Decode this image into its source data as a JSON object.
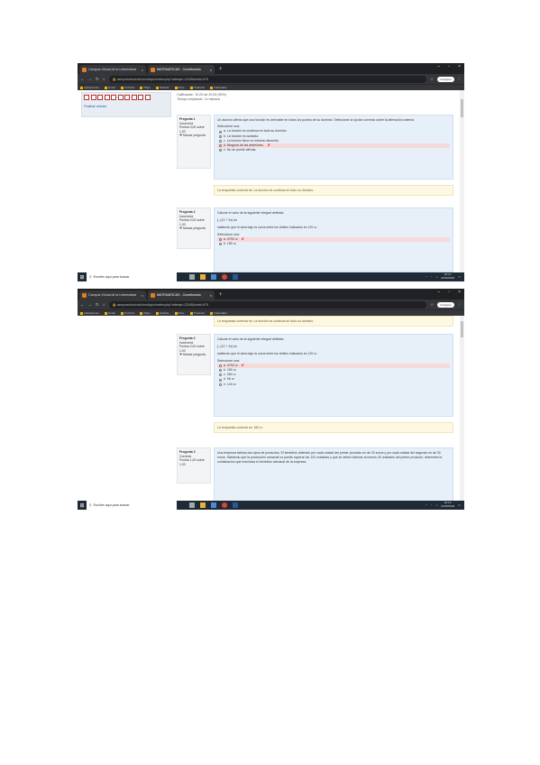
{
  "screens": [
    {
      "tabs": [
        {
          "title": "Campus Virtual de la Universidad"
        },
        {
          "title": "MATEMATICAS - Cuestionario"
        }
      ],
      "url": "campusvirtual.edu/mod/quiz/review.php?attempt=12345&cmid=678",
      "profile": "Incógnito",
      "bookmarks": [
        "Aplicaciones",
        "Gmail",
        "YouTube",
        "Maps",
        "Noticias",
        "Drive",
        "Traductor",
        "Calendario"
      ],
      "info_rows": [
        {
          "label": "Calificación",
          "value": "10,00 de 20,00 (50%)"
        },
        {
          "label": "Tiempo empleado",
          "value": "14 minutos"
        }
      ],
      "finish_review": "Finalizar revisión",
      "q1": {
        "header": "Pregunta 1",
        "state": "Incorrecta",
        "score": "Puntúa 0,00 sobre 1,00",
        "flag": "Marcar pregunta",
        "text": "Un alumno afirma que una función es derivable en todos los puntos de su dominio. Seleccione la opción correcta sobre la afirmación anterior.",
        "prompt": "Seleccione una:",
        "options": [
          {
            "label": "a. La función es continua en todo su dominio.",
            "state": ""
          },
          {
            "label": "b. La función es acotada.",
            "state": ""
          },
          {
            "label": "c. La función tiene un máximo absoluto.",
            "state": ""
          },
          {
            "label": "d. Ninguna de las anteriores.",
            "state": "wrong",
            "mark": "✗"
          },
          {
            "label": "e. No se puede afirmar.",
            "state": ""
          }
        ],
        "feedback": "La respuesta correcta es: La función es continua en todo su dominio."
      },
      "q2": {
        "header": "Pregunta 2",
        "state": "Incorrecta",
        "score": "Puntúa 0,00 sobre 1,00",
        "flag": "Marcar pregunta",
        "text": "Calcule el valor de la siguiente integral definida:",
        "formula": "∫₀ (12 + 3x) dx",
        "text2": "sabiendo que el área bajo la curva entre los límites indicados es 120 u².",
        "prompt": "Seleccione una:",
        "options": [
          {
            "label": "a. 4792 u²",
            "state": "wrong",
            "mark": "✗"
          },
          {
            "label": "b. 180 u²",
            "state": ""
          }
        ]
      },
      "taskbar": {
        "search": "Escribe aquí para buscar",
        "time": "20:14",
        "date": "21/05/2020"
      }
    },
    {
      "tabs": [
        {
          "title": "Campus Virtual de la Universidad"
        },
        {
          "title": "MATEMATICAS - Cuestionario"
        }
      ],
      "url": "campusvirtual.edu/mod/quiz/review.php?attempt=12345&cmid=678",
      "profile": "Incógnito",
      "bookmarks": [
        "Aplicaciones",
        "Gmail",
        "YouTube",
        "Maps",
        "Noticias",
        "Drive",
        "Traductor",
        "Calendario"
      ],
      "top_feedback": "La respuesta correcta es: La función es continua en todo su dominio.",
      "q2": {
        "header": "Pregunta 2",
        "state": "Incorrecta",
        "score": "Puntúa 0,00 sobre 1,00",
        "flag": "Marcar pregunta",
        "text": "Calcule el valor de la siguiente integral definida:",
        "formula": "∫₀ (12 + 3x) dx",
        "text2": "sabiendo que el área bajo la curva entre los límites indicados es 120 u².",
        "prompt": "Seleccione una:",
        "options": [
          {
            "label": "a. 4792 u²",
            "state": "wrong",
            "mark": "✗"
          },
          {
            "label": "b. 180 u²",
            "state": ""
          },
          {
            "label": "c. 264 u²",
            "state": ""
          },
          {
            "label": "d. 96 u²",
            "state": ""
          },
          {
            "label": "e. 144 u²",
            "state": ""
          }
        ],
        "feedback": "La respuesta correcta es: 180 u²"
      },
      "q3": {
        "header": "Pregunta 3",
        "state": "Correcta",
        "score": "Puntúa 1,00 sobre 1,00",
        "text": "Una empresa fabrica dos tipos de productos. El beneficio obtenido por cada unidad del primer producto es de 20 euros y por cada unidad del segundo es de 30 euros. Sabiendo que la producción semanal no puede superar las 120 unidades y que se deben fabricar al menos 40 unidades del primer producto, determine la combinación que maximiza el beneficio semanal de la empresa."
      },
      "taskbar": {
        "search": "Escribe aquí para buscar",
        "time": "20:15",
        "date": "21/05/2020"
      }
    }
  ]
}
